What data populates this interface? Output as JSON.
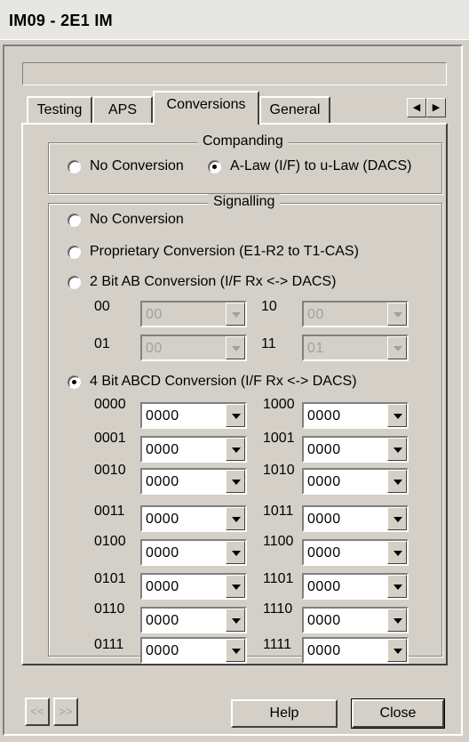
{
  "window": {
    "title": "IM09 - 2E1 IM"
  },
  "tabs": [
    {
      "label": "Testing"
    },
    {
      "label": "APS"
    },
    {
      "label": "Conversions"
    },
    {
      "label": "General"
    }
  ],
  "tab_scroll": {
    "left": "◀",
    "right": "▶"
  },
  "companding": {
    "title": "Companding",
    "options": [
      {
        "label": "No Conversion",
        "selected": false
      },
      {
        "label": "A-Law (I/F) to u-Law (DACS)",
        "selected": true
      }
    ]
  },
  "signalling": {
    "title": "Signalling",
    "options": [
      {
        "label": "No Conversion",
        "selected": false
      },
      {
        "label": "Proprietary Conversion (E1-R2 to T1-CAS)",
        "selected": false
      },
      {
        "label": "2 Bit AB Conversion (I/F Rx <-> DACS)",
        "selected": false
      },
      {
        "label": "4 Bit ABCD Conversion (I/F Rx <-> DACS)",
        "selected": true
      }
    ],
    "ab_map": [
      {
        "code": "00",
        "value": "00"
      },
      {
        "code": "10",
        "value": "00"
      },
      {
        "code": "01",
        "value": "00"
      },
      {
        "code": "11",
        "value": "01"
      }
    ],
    "abcd_map": [
      {
        "code": "0000",
        "value": "0000"
      },
      {
        "code": "1000",
        "value": "0000"
      },
      {
        "code": "0001",
        "value": "0000"
      },
      {
        "code": "1001",
        "value": "0000"
      },
      {
        "code": "0010",
        "value": "0000"
      },
      {
        "code": "1010",
        "value": "0000"
      },
      {
        "code": "0011",
        "value": "0000"
      },
      {
        "code": "1011",
        "value": "0000"
      },
      {
        "code": "0100",
        "value": "0000"
      },
      {
        "code": "1100",
        "value": "0000"
      },
      {
        "code": "0101",
        "value": "0000"
      },
      {
        "code": "1101",
        "value": "0000"
      },
      {
        "code": "0110",
        "value": "0000"
      },
      {
        "code": "1110",
        "value": "0000"
      },
      {
        "code": "0111",
        "value": "0000"
      },
      {
        "code": "1111",
        "value": "0000"
      }
    ]
  },
  "footer": {
    "prev": "<<",
    "next": ">>",
    "help": "Help",
    "close": "Close"
  }
}
